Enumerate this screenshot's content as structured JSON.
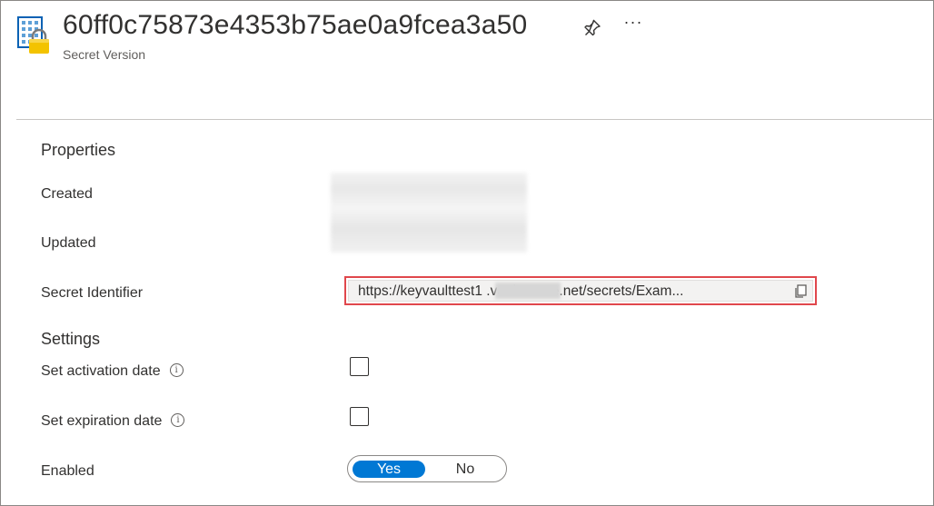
{
  "header": {
    "title": "60ff0c75873e4353b75ae0a9fcea3a50",
    "subtitle": "Secret Version",
    "icon": "key-vault-secret-icon",
    "actions": [
      "pin-icon",
      "more-icon"
    ],
    "more_glyph": "···"
  },
  "properties": {
    "section_title": "Properties",
    "created_label": "Created",
    "updated_label": "Updated",
    "secret_identifier_label": "Secret Identifier",
    "secret_identifier_value": "https://keyvaulttest1           .vault.azure.net/secrets/Exam..."
  },
  "settings": {
    "section_title": "Settings",
    "activation_label": "Set activation date",
    "activation_checked": false,
    "expiration_label": "Set expiration date",
    "expiration_checked": false,
    "enabled_label": "Enabled",
    "enabled_yes": "Yes",
    "enabled_no": "No",
    "enabled_value": "Yes",
    "info_glyph": "i"
  },
  "colors": {
    "accent": "#0078d4",
    "highlight_border": "#e0474c",
    "field_background": "#f3f2f1"
  }
}
